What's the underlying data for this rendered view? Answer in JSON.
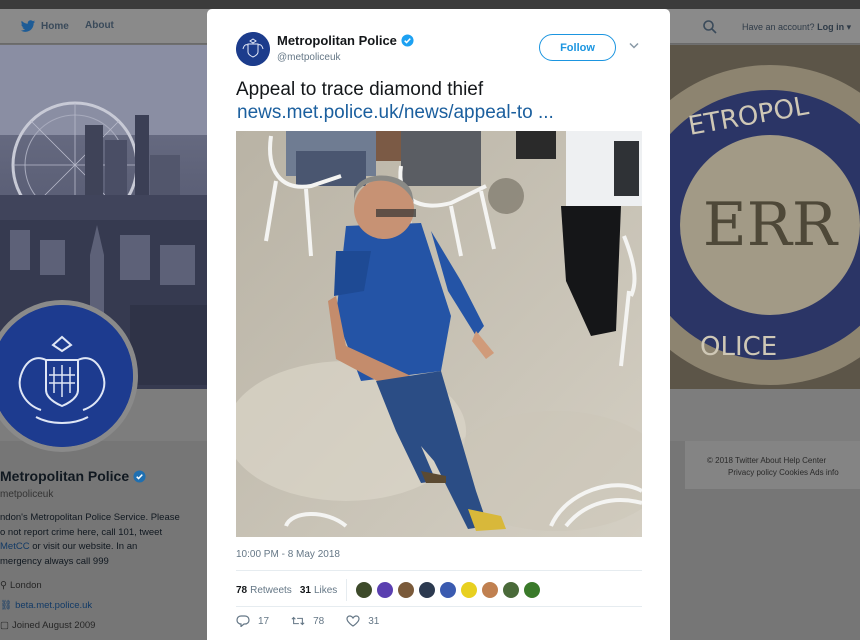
{
  "nav": {
    "home_label": "Home",
    "about_label": "About",
    "account_prefix": "Have an account?",
    "login_label": "Log in"
  },
  "profile": {
    "name": "Metropolitan Police",
    "handle": "metpoliceuk",
    "bio_line1": "ndon's Metropolitan Police Service. Please",
    "bio_line2": "o not report crime here, call 101, tweet",
    "bio_link": "MetCC",
    "bio_line3_rest": " or visit our website. In an",
    "bio_line4": "mergency always call 999",
    "location": "London",
    "website": "beta.met.police.uk",
    "joined": "Joined August 2009"
  },
  "footer": {
    "line1": "© 2018 Twitter   About   Help Center",
    "line2": "Privacy policy   Cookies   Ads info"
  },
  "tweet": {
    "author_name": "Metropolitan Police",
    "author_handle": "@metpoliceuk",
    "follow_label": "Follow",
    "text": "Appeal to trace diamond thief",
    "link_text": "news.met.police.uk/news/appeal-to ...",
    "timestamp": "10:00 PM - 8 May 2018",
    "retweets_count": "78",
    "retweets_label": "Retweets",
    "likes_count": "31",
    "likes_label": "Likes",
    "reply_count": "17",
    "retweet_action_count": "78",
    "like_action_count": "31",
    "liker_colors": [
      "#3d4a2a",
      "#5a3fb0",
      "#7a5a3a",
      "#2c3a50",
      "#3b5bb0",
      "#e8d020",
      "#c08050",
      "#4a6a3a",
      "#3a7a2a"
    ]
  },
  "colors": {
    "twitter_blue": "#1b95e0",
    "link_blue": "#1b5f9e",
    "verified_blue": "#1da1f2",
    "police_blue": "#1c3c8c"
  }
}
